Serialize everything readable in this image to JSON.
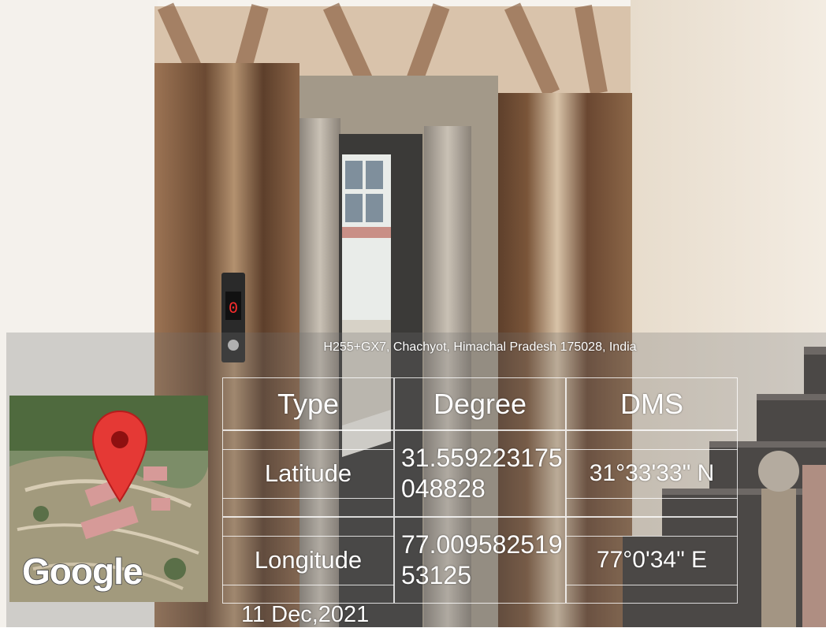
{
  "address": "H255+GX7, Chachyot, Himachal Pradesh 175028, India",
  "map": {
    "brand": "Google",
    "pin_color": "#e53935"
  },
  "table": {
    "headers": [
      "Type",
      "Degree",
      "DMS"
    ],
    "rows": [
      {
        "type": "Latitude",
        "degree": "31.559223175048828",
        "dms": "31°33'33\" N"
      },
      {
        "type": "Longitude",
        "degree": "77.00958251953125",
        "dms": "77°0'34\" E"
      }
    ]
  },
  "date": "11 Dec,2021",
  "elevator": {
    "floor_display": "0"
  }
}
